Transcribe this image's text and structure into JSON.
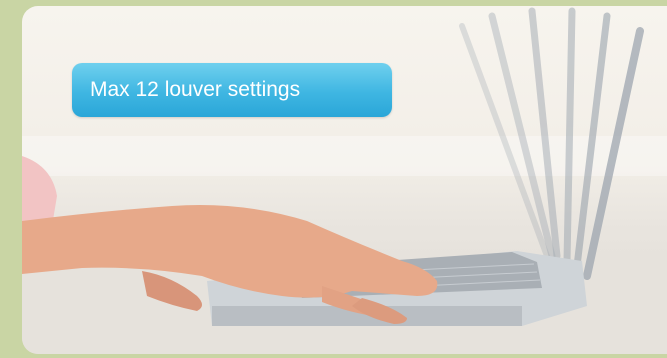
{
  "overlay": {
    "label": "Max 12 louver settings"
  },
  "colors": {
    "border_green": "#c9d5a4",
    "badge_blue": "#3fb6e2",
    "badge_text": "#ffffff"
  },
  "photo": {
    "subject": "laptop-with-hand-icon"
  }
}
